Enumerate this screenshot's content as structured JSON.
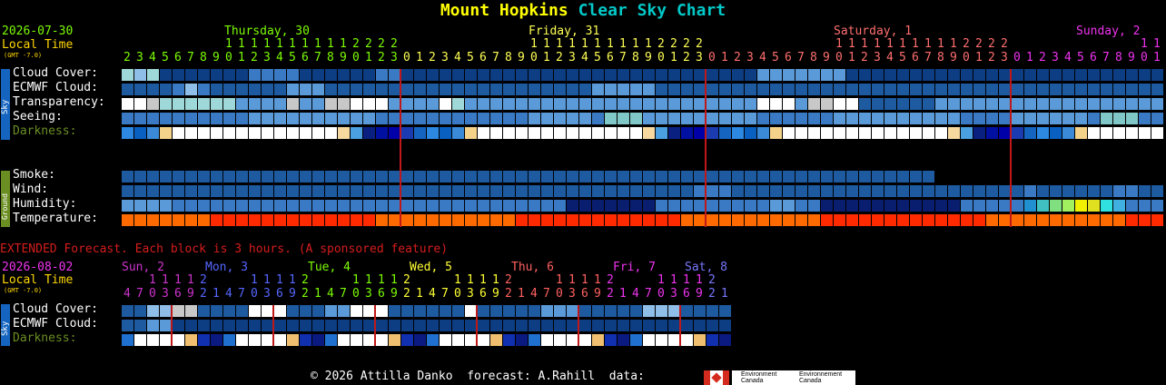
{
  "header": {
    "title_a": "Mount Hopkins",
    "title_b": "Clear Sky Chart",
    "date": "2026-07-30",
    "local_time": "Local Time",
    "gmt": "(GMT -7.0)",
    "days": [
      {
        "label": "Thursday, 30",
        "color": "#7cfc00"
      },
      {
        "label": "Friday, 31",
        "color": "#ffff55"
      },
      {
        "label": "Saturday, 1",
        "color": "#ff6e6e"
      },
      {
        "label": "Sunday, 2",
        "color": "#ee33ee"
      }
    ],
    "hour_tens": " 1 1 1 1 1 1 1 1 1 1 1 2 2 2 2 ",
    "hours_day1_start": "2 3 4 5 6 7 8 9 0 1 2 3 4 5 6 7 8 9 0 1 2 3",
    "hours": "2345678901234567890123"
  },
  "sky_rows": {
    "sidebar": "Sky",
    "labels": [
      "Cloud Cover:",
      "ECMWF Cloud:",
      "Transparency:",
      "Seeing:",
      "Darkness:"
    ]
  },
  "ground_rows": {
    "sidebar": "Ground",
    "labels": [
      "Smoke:",
      "Wind:",
      "Humidity:",
      "Temperature:"
    ]
  },
  "extended": {
    "title": "EXTENDED Forecast. Each block is 3 hours. (A sponsored feature)",
    "date": "2026-08-02",
    "local_time": "Local Time",
    "gmt": "(GMT -7.0)",
    "days": [
      {
        "label": "Sun, 2",
        "color": "#cc33cc"
      },
      {
        "label": "Mon, 3",
        "color": "#5566ff"
      },
      {
        "label": "Tue, 4",
        "color": "#7cfc00"
      },
      {
        "label": "Wed, 5",
        "color": "#ffff33"
      },
      {
        "label": "Thu, 6",
        "color": "#ff6060"
      },
      {
        "label": "Fri, 7",
        "color": "#ee33ee"
      },
      {
        "label": "Sat, 8",
        "color": "#7777ff"
      }
    ],
    "sidebar": "Sky",
    "labels": [
      "Cloud Cover:",
      "ECMWF Cloud:",
      "Darkness:"
    ]
  },
  "footer": {
    "copyright": "© 2026 Attilla Danko",
    "forecast": "forecast: A.Rahill",
    "data": "data:",
    "ec_line1": "Environment",
    "ec_line2": "Canada",
    "ec_line3": "Environnement",
    "ec_line4": "Canada"
  },
  "colors": {
    "deep_blue": "#0d3d82",
    "blue": "#1c5a9c",
    "light_blue": "#4b8bd0",
    "pale_blue": "#8fb8e0",
    "white": "#ffffff",
    "orange": "#ff6a00",
    "red": "#ff2200"
  }
}
